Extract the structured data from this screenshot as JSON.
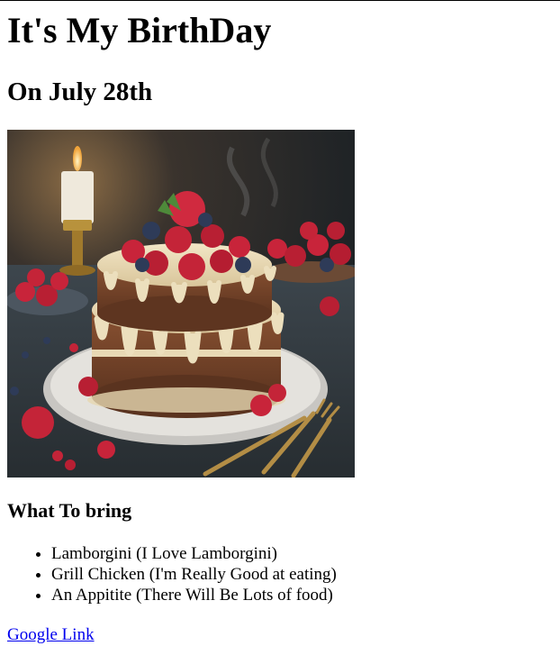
{
  "header": {
    "title": "It's My BirthDay",
    "subtitle": "On July 28th"
  },
  "image": {
    "icon": "birthday-cake-image"
  },
  "bring": {
    "heading": "What To bring",
    "items": [
      "Lamborgini (I Love Lamborgini)",
      "Grill Chicken (I'm Really Good at eating)",
      "An Appitite (There Will Be Lots of food)"
    ]
  },
  "footer": {
    "link_label": "Google Link"
  },
  "colors": {
    "link": "#0000ee",
    "text": "#000000",
    "background": "#ffffff"
  }
}
